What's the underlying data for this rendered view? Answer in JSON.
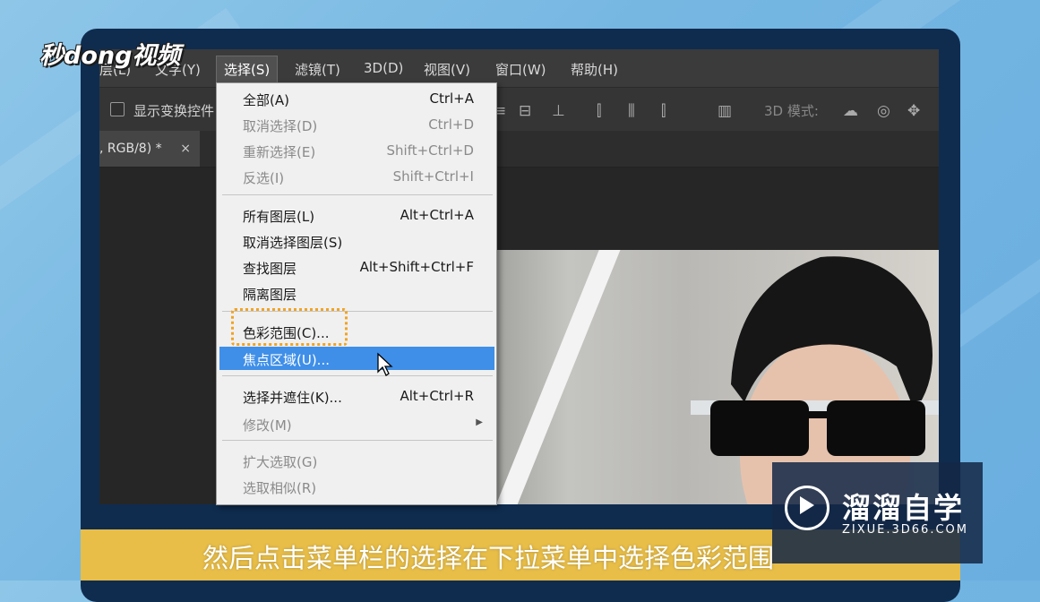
{
  "logo": "秒dong视频",
  "menubar": {
    "items": [
      "层(L)",
      "文字(Y)",
      "选择(S)",
      "滤镜(T)",
      "3D(D)",
      "视图(V)",
      "窗口(W)",
      "帮助(H)"
    ]
  },
  "options_bar": {
    "checkbox_label": "显示变换控件",
    "mode_label": "3D 模式:"
  },
  "document_tab": {
    "title": ", RGB/8) *",
    "close": "×"
  },
  "select_menu": {
    "items": [
      {
        "label": "全部(A)",
        "shortcut": "Ctrl+A",
        "enabled": true
      },
      {
        "label": "取消选择(D)",
        "shortcut": "Ctrl+D",
        "enabled": false
      },
      {
        "label": "重新选择(E)",
        "shortcut": "Shift+Ctrl+D",
        "enabled": false
      },
      {
        "label": "反选(I)",
        "shortcut": "Shift+Ctrl+I",
        "enabled": false
      },
      {
        "label": "所有图层(L)",
        "shortcut": "Alt+Ctrl+A",
        "enabled": true
      },
      {
        "label": "取消选择图层(S)",
        "shortcut": "",
        "enabled": true
      },
      {
        "label": "查找图层",
        "shortcut": "Alt+Shift+Ctrl+F",
        "enabled": true
      },
      {
        "label": "隔离图层",
        "shortcut": "",
        "enabled": true
      },
      {
        "label": "色彩范围(C)...",
        "shortcut": "",
        "enabled": true
      },
      {
        "label": "焦点区域(U)...",
        "shortcut": "",
        "enabled": true,
        "highlighted": true
      },
      {
        "label": "选择并遮住(K)...",
        "shortcut": "Alt+Ctrl+R",
        "enabled": true
      },
      {
        "label": "修改(M)",
        "shortcut": "",
        "enabled": false,
        "submenu": true
      },
      {
        "label": "扩大选取(G)",
        "shortcut": "",
        "enabled": false
      },
      {
        "label": "选取相似(R)",
        "shortcut": "",
        "enabled": false
      }
    ]
  },
  "subtitle": "然后点击菜单栏的选择在下拉菜单中选择色彩范围",
  "watermark": {
    "title": "溜溜自学",
    "url": "ZIXUE.3D66.COM"
  },
  "colors": {
    "highlight": "#3f8fe8",
    "callout": "#f2a320",
    "subtitle_bar": "#e8be48"
  }
}
